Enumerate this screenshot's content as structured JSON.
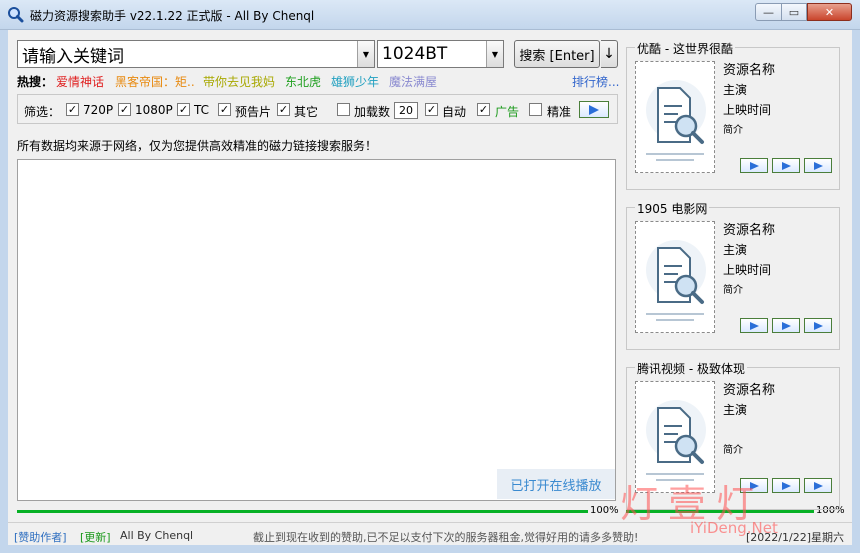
{
  "window": {
    "title": "磁力资源搜索助手 v22.1.22 正式版 - All By Chenql",
    "min_icon": "minimize-icon",
    "max_icon": "maximize-icon",
    "close_icon": "close-icon",
    "min_glyph": "—",
    "max_glyph": "▭",
    "close_glyph": "✕"
  },
  "search": {
    "keyword": "请输入关键词",
    "site": "1024BT",
    "search_label": "搜索 [Enter]",
    "sort_label": "↓",
    "drop_glyph": "▼"
  },
  "hot": {
    "label": "热搜：",
    "items": [
      {
        "text": "爱情神话",
        "color": "#e02020"
      },
      {
        "text": "黑客帝国：矩..",
        "color": "#e88a10"
      },
      {
        "text": "带你去见我妈",
        "color": "#a8a800"
      },
      {
        "text": "东北虎",
        "color": "#20a020"
      },
      {
        "text": "雄狮少年",
        "color": "#20a0c0"
      },
      {
        "text": "魔法满屋",
        "color": "#8a8ad0"
      }
    ],
    "rank_label": "排行榜..."
  },
  "filter": {
    "label": "筛选：",
    "options": [
      {
        "text": "720P",
        "checked": true
      },
      {
        "text": "1080P",
        "checked": true
      },
      {
        "text": "TC",
        "checked": true
      },
      {
        "text": "预告片",
        "checked": true
      },
      {
        "text": "其它",
        "checked": true
      }
    ],
    "load_count_label": "加载数",
    "load_count_checked": false,
    "load_count_value": "20",
    "auto_label": "自动",
    "auto_checked": true,
    "ad_label": "广告",
    "ad_checked": true,
    "ad_color": "#1c9a1c",
    "precise_label": "精准",
    "precise_checked": false,
    "check_glyph": "✓"
  },
  "notice": "所有数据均来源于网络，仅为您提供高效精准的磁力链接搜索服务！",
  "online_play": "已打开在线播放",
  "progress": [
    {
      "label": "100%",
      "value": 100
    },
    {
      "label": "100%",
      "value": 100
    }
  ],
  "panels": [
    {
      "title": "优酷 - 这世界很酷",
      "name": "资源名称",
      "actor": "主演",
      "date": "上映时间",
      "intro": "简介"
    },
    {
      "title": "1905 电影网",
      "name": "资源名称",
      "actor": "主演",
      "date": "上映时间",
      "intro": "简介"
    },
    {
      "title": "腾讯视频 - 极致体现",
      "name": "资源名称",
      "actor": "主演",
      "date": "",
      "intro": "简介"
    }
  ],
  "status": {
    "sponsor": "[赞助作者]",
    "update": "[更新]",
    "author": "All By Chenql",
    "message": "截止到现在收到的赞助,已不足以支付下次的服务器租金,觉得好用的请多多赞助!",
    "date": "[2022/1/22]星期六"
  },
  "watermark": {
    "big": "灯壹灯",
    "small": "iYiDeng.Net"
  },
  "colors": {
    "accent": "#3366cc",
    "progress": "#06b025",
    "play": "#2a6ed8"
  }
}
